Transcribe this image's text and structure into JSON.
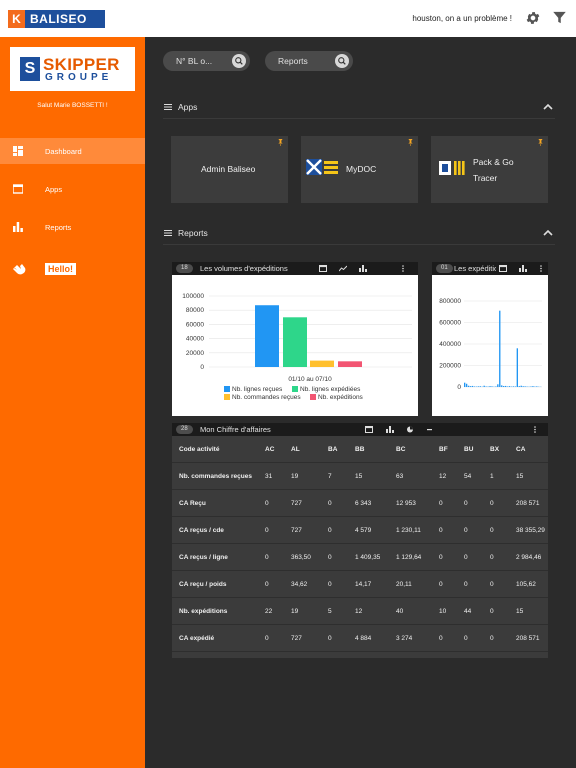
{
  "header": {
    "brand": "BALISEO",
    "brand_letter": "K",
    "user_message": "houston, on a un problème !",
    "icons": {
      "settings": "gear-icon",
      "filter": "filter-icon"
    }
  },
  "sidebar": {
    "logo": {
      "letter": "S",
      "line1": "SKIPPER",
      "line2": "GROUPE"
    },
    "greeting": "Salut Marie BOSSETTI !",
    "items": [
      {
        "label": "Dashboard",
        "icon": "dashboard-icon",
        "active": true
      },
      {
        "label": "Apps",
        "icon": "apps-icon",
        "active": false
      },
      {
        "label": "Reports",
        "icon": "reports-icon",
        "active": false
      }
    ],
    "hello": "Hello!"
  },
  "search": [
    {
      "placeholder": "N° BL o..."
    },
    {
      "placeholder": "Reports"
    }
  ],
  "sections": {
    "apps": "Apps",
    "reports": "Reports"
  },
  "apps": [
    {
      "name": "Admin Baliseo"
    },
    {
      "name": "MyDOC"
    },
    {
      "name": "Pack & Go Tracer"
    }
  ],
  "cards": {
    "volumes": {
      "count": "18",
      "title": "Les volumes d'expéditions",
      "x_label": "01/10 au 07/10"
    },
    "expeditions": {
      "count": "01",
      "title": "Les expéditions"
    },
    "ca": {
      "count": "28",
      "title": "Mon Chiffre d'affaires"
    }
  },
  "chart_data": [
    {
      "type": "bar",
      "title": "Les volumes d'expéditions",
      "xlabel": "01/10 au 07/10",
      "ylabel": "",
      "ylim": [
        0,
        100000
      ],
      "yticks": [
        "100000",
        "80000",
        "60000",
        "40000",
        "20000",
        "0"
      ],
      "series": [
        {
          "name": "Nb. lignes reçues",
          "color": "#2196f3",
          "values": [
            87000
          ]
        },
        {
          "name": "Nb. lignes expédiées",
          "color": "#2ed68a",
          "values": [
            70000
          ]
        },
        {
          "name": "Nb. commandes reçues",
          "color": "#ffc02e",
          "values": [
            9000
          ]
        },
        {
          "name": "Nb. expéditions",
          "color": "#f25572",
          "values": [
            8000
          ]
        }
      ]
    },
    {
      "type": "bar",
      "title": "Les expéditions",
      "ylim": [
        0,
        800000
      ],
      "yticks": [
        "800000",
        "600000",
        "400000",
        "200000",
        "0"
      ],
      "color": "#2196f3",
      "values": [
        40000,
        30000,
        12000,
        8000,
        10000,
        5000,
        4000,
        6000,
        7000,
        3000,
        12000,
        5000,
        4000,
        8000,
        6000,
        3000,
        5000,
        25000,
        710000,
        15000,
        9000,
        10000,
        5000,
        8000,
        4000,
        6000,
        5000,
        360000,
        8000,
        12000,
        7000,
        6000,
        4000,
        3000,
        5000,
        8000,
        4000,
        6000,
        3000,
        2000
      ]
    }
  ],
  "table": {
    "columns": [
      "Code activité",
      "AC",
      "AL",
      "BA",
      "BB",
      "BC",
      "BF",
      "BU",
      "BX",
      "CA"
    ],
    "rows": [
      [
        "Nb. commandes reçues",
        "31",
        "19",
        "7",
        "15",
        "63",
        "12",
        "54",
        "1",
        "15"
      ],
      [
        "CA Reçu",
        "0",
        "727",
        "0",
        "6 343",
        "12 953",
        "0",
        "0",
        "0",
        "208 571"
      ],
      [
        "CA reçus / cde",
        "0",
        "727",
        "0",
        "4 579",
        "1 230,11",
        "0",
        "0",
        "0",
        "38 355,29"
      ],
      [
        "CA reçus / ligne",
        "0",
        "363,50",
        "0",
        "1 409,35",
        "1 129,64",
        "0",
        "0",
        "0",
        "2 984,46"
      ],
      [
        "CA reçu / poids",
        "0",
        "34,62",
        "0",
        "14,17",
        "20,11",
        "0",
        "0",
        "0",
        "105,62"
      ],
      [
        "Nb. expéditions",
        "22",
        "19",
        "5",
        "12",
        "40",
        "10",
        "44",
        "0",
        "15"
      ],
      [
        "CA expédié",
        "0",
        "727",
        "0",
        "4 884",
        "3 274",
        "0",
        "0",
        "0",
        "208 571"
      ]
    ]
  },
  "colors": {
    "sidebar": "#fe6a00",
    "active_item": "#ff8a3a",
    "content_bg": "#2b2b2b",
    "tile_bg": "#3c3c3c",
    "brand_blue": "#1d4f9c"
  }
}
